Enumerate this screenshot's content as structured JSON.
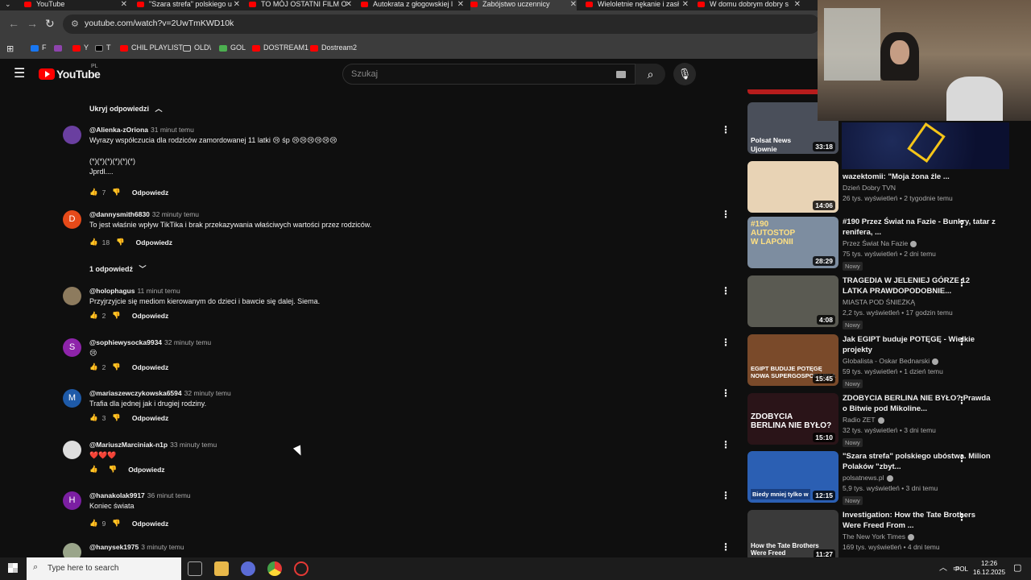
{
  "browser": {
    "tabs": [
      {
        "title": "YouTube"
      },
      {
        "title": "\"Szara strefa\" polskiego u"
      },
      {
        "title": "TO MÓJ OSTATNI FILM O"
      },
      {
        "title": "Autokrata z głogowskiej l"
      },
      {
        "title": "Zabójstwo uczennicy"
      },
      {
        "title": "Wieloletnie nękanie i zasł"
      },
      {
        "title": "W domu dobrym dobry s"
      }
    ],
    "url": "youtube.com/watch?v=2UwTmKWD10k",
    "bookmarks": [
      {
        "label": "F",
        "color": "#1877f2"
      },
      {
        "label": "",
        "color": "#8e44ad"
      },
      {
        "label": "Y",
        "color": "#ff0000"
      },
      {
        "label": "T",
        "color": "#000000"
      },
      {
        "label": "CHIL PLAYLIST",
        "color": "#ff0000"
      },
      {
        "label": "OLD\\",
        "color": "#cccccc"
      },
      {
        "label": "GOL",
        "color": "#4caf50"
      },
      {
        "label": "DOSTREAM1",
        "color": "#ff0000"
      },
      {
        "label": "Dostream2",
        "color": "#ff0000"
      }
    ]
  },
  "youtube": {
    "logo_text": "YouTube",
    "country": "PL",
    "search_placeholder": "Szukaj"
  },
  "comments": {
    "hide_replies_label": "Ukryj odpowiedzi",
    "one_reply_label": "1 odpowiedź",
    "reply_label": "Odpowiedz",
    "items": [
      {
        "author": "@Alienka-zOriona",
        "time": "31 minut temu",
        "text": "Wyrazy współczucia dla rodziców zamordowanej 11 latki 😢 śp 😢😢😢😢😢😢\n\n(*)(*)(*)(*)(*)(*)\nJprdl....",
        "likes": "7",
        "avatar_color": "#6a3fa0",
        "avatar_letter": ""
      },
      {
        "author": "@dannysmith6830",
        "time": "32 minuty temu",
        "text": "To jest właśnie wpływ TikTika i brak przekazywania właściwych wartości przez rodziców.",
        "likes": "18",
        "avatar_color": "#e64a19",
        "avatar_letter": "D"
      },
      {
        "author": "@holophagus",
        "time": "11 minut temu",
        "text": "Przyjrzyjcie się mediom kierowanym do dzieci i bawcie się dalej. Siema.",
        "likes": "2",
        "avatar_color": "#8d7b5e",
        "avatar_letter": ""
      },
      {
        "author": "@sophiewysocka9934",
        "time": "32 minuty temu",
        "text": "😢",
        "likes": "2",
        "avatar_color": "#8e24aa",
        "avatar_letter": "S"
      },
      {
        "author": "@mariaszewczykowska6594",
        "time": "32 minuty temu",
        "text": "Trafia dla jednej jak i drugiej rodziny.",
        "likes": "3",
        "avatar_color": "#1e5aa8",
        "avatar_letter": "M"
      },
      {
        "author": "@MariuszMarciniak-n1p",
        "time": "33 minuty temu",
        "text": "❤️❤️❤️",
        "likes": "",
        "avatar_color": "#dddddd",
        "avatar_letter": ""
      },
      {
        "author": "@hanakolak9917",
        "time": "36 minut temu",
        "text": "Koniec świata",
        "likes": "9",
        "avatar_color": "#7b1fa2",
        "avatar_letter": "H"
      },
      {
        "author": "@hanysek1975",
        "time": "3 minuty temu",
        "text": "",
        "likes": "",
        "avatar_color": "#9aa58a",
        "avatar_letter": ""
      }
    ]
  },
  "sidebar": {
    "videos": [
      {
        "title": "",
        "channel": "",
        "meta": "",
        "badge": "",
        "duration": "33:18",
        "thumb_text": "Polsat News\nUjownie",
        "thumb_color": "#4a4f5a"
      },
      {
        "title": "wazektomii: \"Moja żona źle ...",
        "channel": "Dzień Dobry TVN",
        "meta": "26 tys. wyświetleń • 2 tygodnie temu",
        "badge": "",
        "duration": "14:06",
        "thumb_text": "",
        "thumb_color": "#e8d3b5"
      },
      {
        "title": "#190 Przez Świat na Fazie - Bunkry, tatar z renifera, ...",
        "channel": "Przez Świat Na Fazie",
        "meta": "75 tys. wyświetleń • 2 dni temu",
        "badge": "Nowy",
        "duration": "28:29",
        "thumb_text": "#190\nAUTOSTOP\nW LAPONII",
        "thumb_color": "#7d8da0"
      },
      {
        "title": "TRAGEDIA W JELENIEJ GÓRZE 12 LATKA PRAWDOPODOBNIE...",
        "channel": "MIASTA POD ŚNIEŻKĄ",
        "meta": "2,2 tys. wyświetleń • 17 godzin temu",
        "badge": "Nowy",
        "duration": "4:08",
        "thumb_text": "",
        "thumb_color": "#5a5a52"
      },
      {
        "title": "Jak EGIPT buduje POTĘGĘ - Wielkie projekty",
        "channel": "Globalista - Oskar Bednarski",
        "meta": "59 tys. wyświetleń • 1 dzień temu",
        "badge": "Nowy",
        "duration": "15:45",
        "thumb_text": "EGIPT BUDUJE POTĘGĘ\nNOWA SUPERGOSPODARKA",
        "thumb_color": "#7a4a2a"
      },
      {
        "title": "ZDOBYCIA BERLINA NIE BYŁO? Prawda o Bitwie pod Mikoline...",
        "channel": "Radio ZET",
        "meta": "32 tys. wyświetleń • 3 dni temu",
        "badge": "Nowy",
        "duration": "15:10",
        "thumb_text": "ZDOBYCIA\nBERLINA NIE BYŁO?",
        "thumb_color": "#2a1418"
      },
      {
        "title": "\"Szara strefa\" polskiego ubóstwa. Milion Polaków \"zbyt...",
        "channel": "polsatnews.pl",
        "meta": "5,9 tys. wyświetleń • 3 dni temu",
        "badge": "Nowy",
        "duration": "12:15",
        "thumb_text": "Biedy mniej tylko w",
        "thumb_color": "#2b5fb3"
      },
      {
        "title": "Investigation: How the Tate Brothers Were Freed From ...",
        "channel": "The New York Times",
        "meta": "169 tys. wyświetleń • 4 dni temu",
        "badge": "",
        "duration": "11:27",
        "thumb_text": "How the Tate Brothers\nWere Freed",
        "thumb_color": "#3a3a3a"
      }
    ]
  },
  "taskbar": {
    "search_placeholder": "Type here to search",
    "language": "POL",
    "time": "12:26",
    "date": "16.12.2025"
  }
}
